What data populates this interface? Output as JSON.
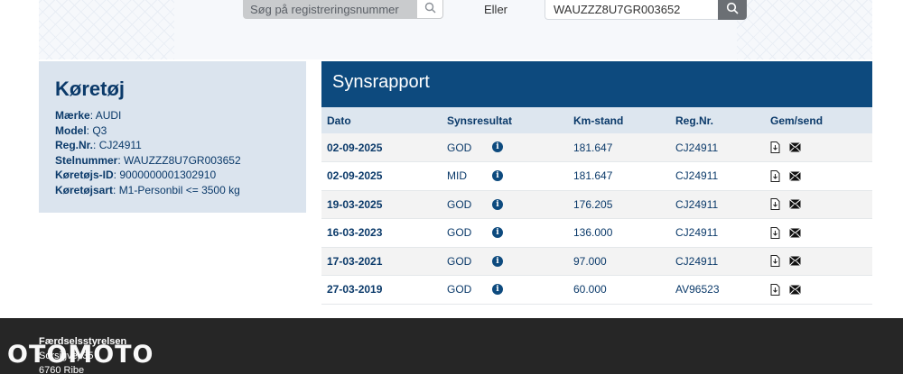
{
  "search": {
    "placeholder": "Søg på registreringsnummer",
    "or_label": "Eller",
    "vin_value": "WAUZZZ8U7GR003652"
  },
  "vehicle": {
    "title": "Køretøj",
    "fields": [
      {
        "label": "Mærke",
        "value": "AUDI"
      },
      {
        "label": "Model",
        "value": "Q3"
      },
      {
        "label": "Reg.Nr.",
        "value": "CJ24911"
      },
      {
        "label": "Stelnummer",
        "value": "WAUZZZ8U7GR003652"
      },
      {
        "label": "Køretøjs-ID",
        "value": "9000000001302910"
      },
      {
        "label": "Køretøjsart",
        "value": "M1-Personbil <= 3500 kg"
      }
    ]
  },
  "report": {
    "title": "Synsrapport",
    "columns": [
      "Dato",
      "Synsresultat",
      "Km-stand",
      "Reg.Nr.",
      "Gem/send"
    ],
    "rows": [
      {
        "date": "02-09-2025",
        "result": "GOD",
        "km": "181.647",
        "reg": "CJ24911"
      },
      {
        "date": "02-09-2025",
        "result": "MID",
        "km": "181.647",
        "reg": "CJ24911"
      },
      {
        "date": "19-03-2025",
        "result": "GOD",
        "km": "176.205",
        "reg": "CJ24911"
      },
      {
        "date": "16-03-2023",
        "result": "GOD",
        "km": "136.000",
        "reg": "CJ24911"
      },
      {
        "date": "17-03-2021",
        "result": "GOD",
        "km": "97.000",
        "reg": "CJ24911"
      },
      {
        "date": "27-03-2019",
        "result": "GOD",
        "km": "60.000",
        "reg": "AV96523"
      }
    ]
  },
  "footer": {
    "org": "Færdselsstyrelsen",
    "address1": "Sorsigvej 35",
    "address2": "6760 Ribe"
  },
  "watermark": "OTOMOTO",
  "colors": {
    "primary": "#0d4a7e",
    "card_bg": "#dbe4ee",
    "footer_bg": "#262626"
  }
}
